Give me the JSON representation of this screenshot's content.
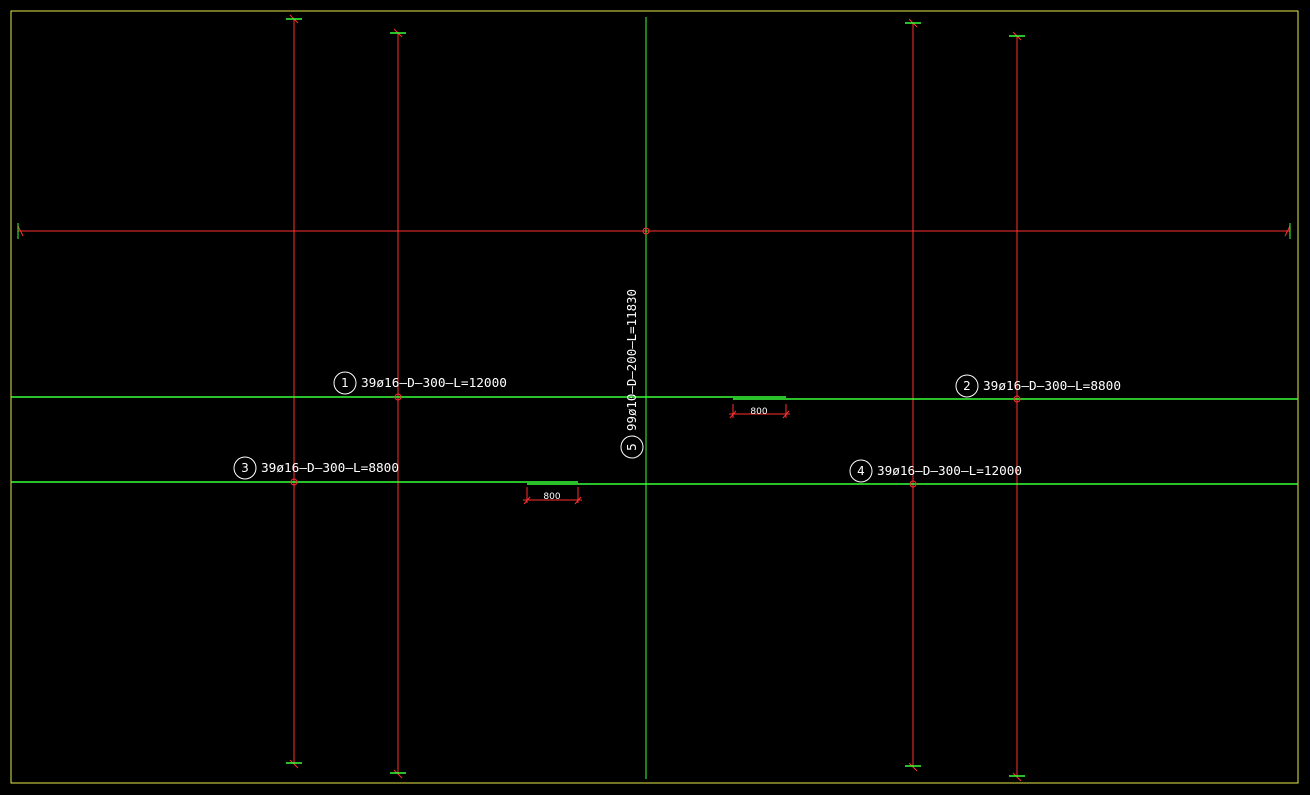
{
  "colors": {
    "background": "#000000",
    "frame": "#e8e84a",
    "distribution_bar": "#ff3030",
    "main_bar": "#39ff39",
    "text": "#ffffff"
  },
  "bars": [
    {
      "mark": "1",
      "spec": "39ø16—D—300—L=12000"
    },
    {
      "mark": "2",
      "spec": "39ø16—D—300—L=8800"
    },
    {
      "mark": "3",
      "spec": "39ø16—D—300—L=8800"
    },
    {
      "mark": "4",
      "spec": "39ø16—D—300—L=12000"
    },
    {
      "mark": "5",
      "spec": "99ø10—D—200—L=11830"
    }
  ],
  "laps": [
    {
      "value": "800"
    },
    {
      "value": "800"
    }
  ]
}
